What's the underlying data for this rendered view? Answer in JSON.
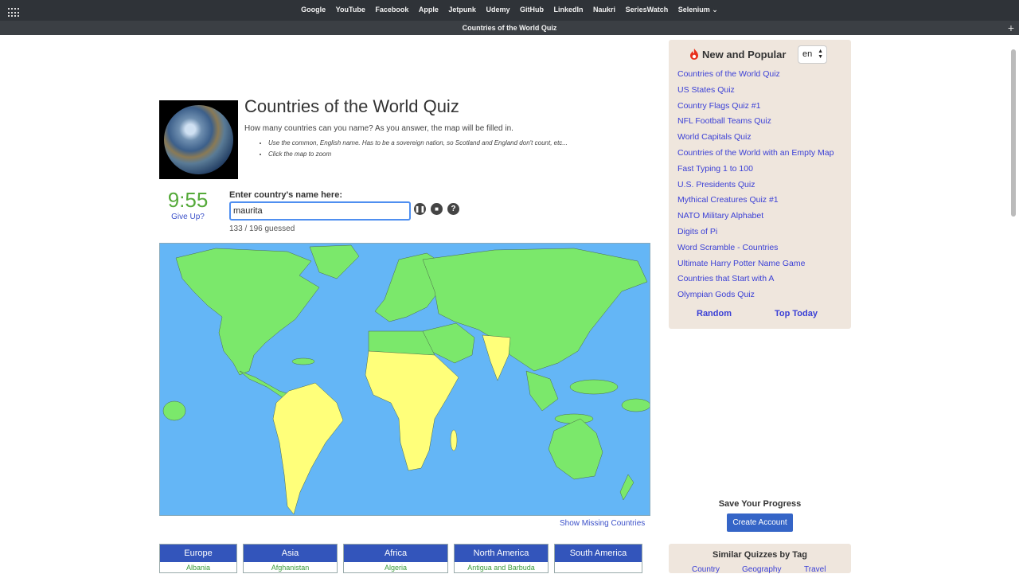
{
  "browser": {
    "bookmarks": [
      "Google",
      "YouTube",
      "Facebook",
      "Apple",
      "Jetpunk",
      "Udemy",
      "GitHub",
      "LinkedIn",
      "Naukri",
      "SeriesWatch",
      "Selenium ⌄"
    ],
    "tab_title": "Countries of the World Quiz"
  },
  "quiz": {
    "title": "Countries of the World Quiz",
    "subtitle": "How many countries can you name? As you answer, the map will be filled in.",
    "notes": [
      "Use the common, English name. Has to be a sovereign nation, so Scotland and England don't count, etc...",
      "Click the map to zoom"
    ],
    "timer": "9:55",
    "give_up": "Give Up?",
    "input_label": "Enter country's name here:",
    "input_value": "maurita",
    "counter": "133 / 196 guessed",
    "show_missing": "Show Missing Countries",
    "colors": {
      "guessed": "#7be86b",
      "missing": "#ffff7a",
      "ocean": "#64b6f6"
    }
  },
  "continents": [
    {
      "name": "Europe",
      "first": "Albania"
    },
    {
      "name": "Asia",
      "first": "Afghanistan"
    },
    {
      "name": "Africa",
      "first": "Algeria"
    },
    {
      "name": "North America",
      "first": "Antigua and Barbuda"
    },
    {
      "name": "South America",
      "first": ""
    }
  ],
  "sidebar": {
    "title": "New and Popular",
    "lang": "en",
    "links": [
      "Countries of the World Quiz",
      "US States Quiz",
      "Country Flags Quiz #1",
      "NFL Football Teams Quiz",
      "World Capitals Quiz",
      "Countries of the World with an Empty Map",
      "Fast Typing 1 to 100",
      "U.S. Presidents Quiz",
      "Mythical Creatures Quiz #1",
      "NATO Military Alphabet",
      "Digits of Pi",
      "Word Scramble - Countries",
      "Ultimate Harry Potter Name Game",
      "Countries that Start with A",
      "Olympian Gods Quiz"
    ],
    "random": "Random",
    "top_today": "Top Today",
    "save_title": "Save Your Progress",
    "create_account": "Create Account",
    "similar_title": "Similar Quizzes by Tag",
    "tags": [
      "Country",
      "Geography",
      "Travel"
    ]
  }
}
